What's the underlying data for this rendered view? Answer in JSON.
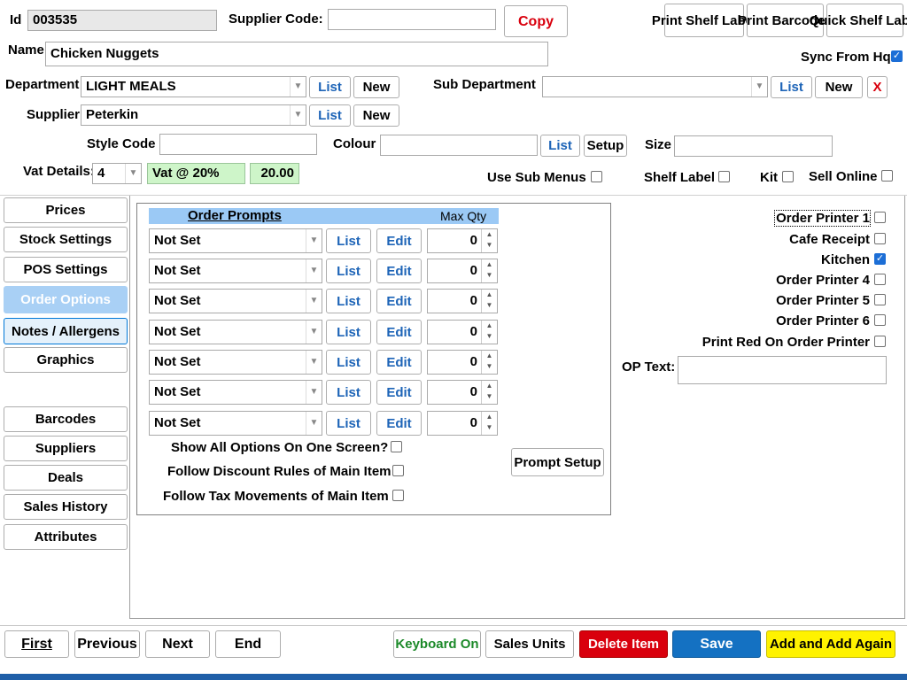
{
  "header": {
    "id_label": "Id",
    "id_value": "003535",
    "supplier_code_label": "Supplier Code:",
    "supplier_code_value": "",
    "copy_label": "Copy",
    "print_shelf_label": "Print Shelf Label",
    "print_barcodes_label": "Print Barcodes",
    "quick_shelf_label": "Quick Shelf Label",
    "name_label": "Name",
    "name_value": "Chicken Nuggets",
    "sync_label": "Sync From Hq",
    "sync_checked": true,
    "department_label": "Department",
    "department_value": "LIGHT MEALS",
    "sub_department_label": "Sub Department",
    "sub_department_value": "",
    "supplier_label": "Supplier",
    "supplier_value": "Peterkin",
    "list_label": "List",
    "new_label": "New",
    "delete_label": "X",
    "style_code_label": "Style Code",
    "style_code_value": "",
    "colour_label": "Colour",
    "colour_value": "",
    "setup_label": "Setup",
    "size_label": "Size",
    "size_value": "",
    "vat_label": "Vat Details:",
    "vat_code": "4",
    "vat_desc": "Vat @ 20%",
    "vat_rate": "20.00",
    "use_sub_menus_label": "Use Sub Menus",
    "shelf_label_label": "Shelf Label",
    "kit_label": "Kit",
    "sell_online_label": "Sell Online"
  },
  "tabs": [
    {
      "label": "Prices"
    },
    {
      "label": "Stock Settings"
    },
    {
      "label": "POS Settings"
    },
    {
      "label": "Order Options"
    },
    {
      "label": "Notes / Allergens"
    },
    {
      "label": "Graphics"
    },
    {
      "label": "Barcodes"
    },
    {
      "label": "Suppliers"
    },
    {
      "label": "Deals"
    },
    {
      "label": "Sales History"
    },
    {
      "label": "Attributes"
    }
  ],
  "order_prompts": {
    "title": "Order Prompts",
    "max_qty_label": "Max Qty",
    "list_label": "List",
    "edit_label": "Edit",
    "rows": [
      {
        "value": "Not Set",
        "qty": "0"
      },
      {
        "value": "Not Set",
        "qty": "0"
      },
      {
        "value": "Not Set",
        "qty": "0"
      },
      {
        "value": "Not Set",
        "qty": "0"
      },
      {
        "value": "Not Set",
        "qty": "0"
      },
      {
        "value": "Not Set",
        "qty": "0"
      },
      {
        "value": "Not Set",
        "qty": "0"
      }
    ],
    "show_all_label": "Show All Options On One Screen?",
    "follow_discount_label": "Follow Discount Rules of Main Item",
    "follow_tax_label": "Follow Tax Movements of Main Item",
    "prompt_setup_label": "Prompt Setup"
  },
  "printers": [
    {
      "label": "Order Printer 1",
      "checked": false
    },
    {
      "label": "Cafe Receipt",
      "checked": false
    },
    {
      "label": "Kitchen",
      "checked": true
    },
    {
      "label": "Order Printer 4",
      "checked": false
    },
    {
      "label": "Order Printer 5",
      "checked": false
    },
    {
      "label": "Order Printer 6",
      "checked": false
    },
    {
      "label": "Print Red On Order Printer",
      "checked": false
    }
  ],
  "op_text_label": "OP Text:",
  "op_text_value": "",
  "footer": {
    "first": "First",
    "previous": "Previous",
    "next": "Next",
    "end": "End",
    "keyboard_on": "Keyboard On",
    "sales_units": "Sales Units",
    "delete_item": "Delete Item",
    "save": "Save",
    "add_again": "Add and Add Again"
  },
  "colors": {
    "active_tab": "#a9d0f5",
    "prompt_header": "#9bc9f5",
    "delete": "#d9000d",
    "save": "#1471c2",
    "add_again": "#fff200",
    "link_blue": "#1d64b7",
    "keyboard_green": "#1d8a2a"
  }
}
